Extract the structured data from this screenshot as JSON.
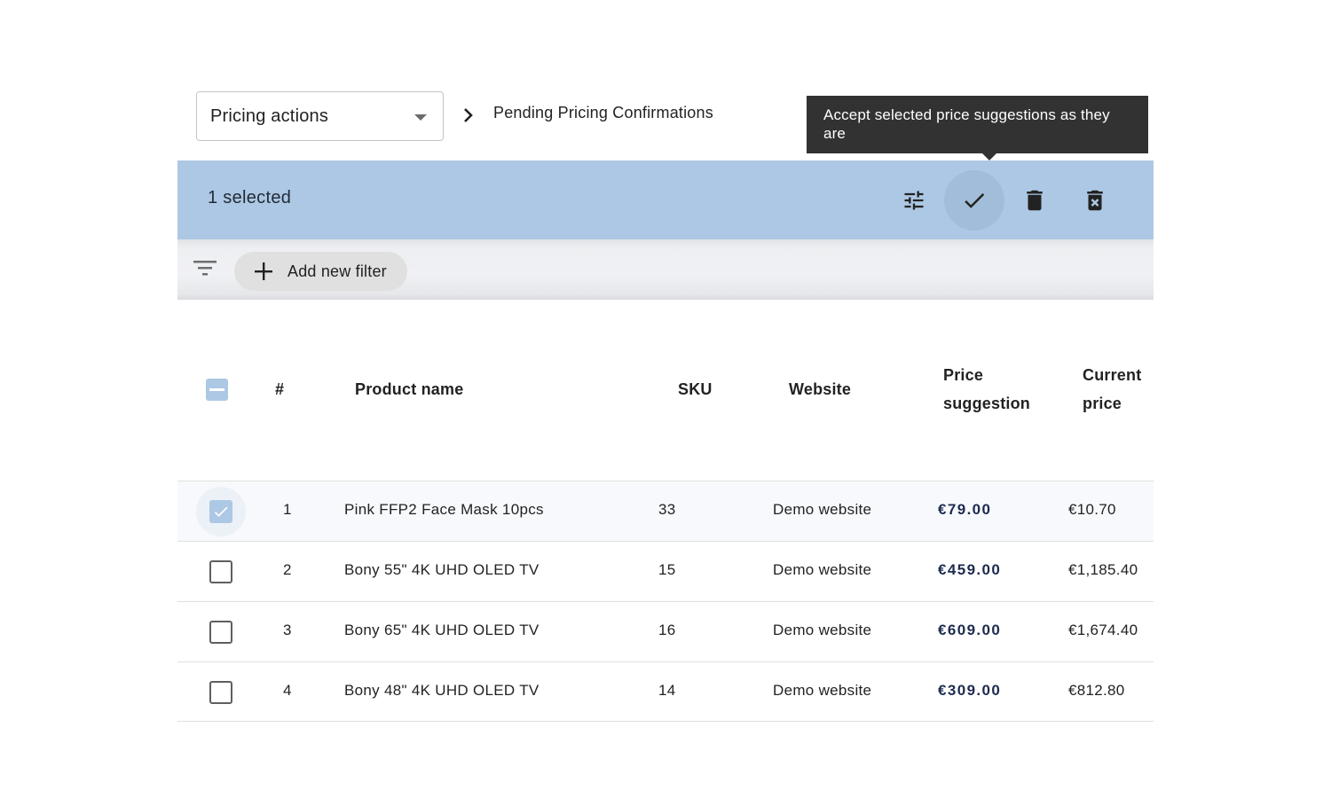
{
  "header": {
    "dropdown": {
      "value": "Pricing actions",
      "icon": "caret-down-icon"
    },
    "breadcrumb": {
      "separator_icon": "chevron-right-icon",
      "current": "Pending Pricing Confirmations"
    }
  },
  "tooltip": {
    "text": "Accept selected price suggestions as they are"
  },
  "selection_bar": {
    "count_label": "1 selected",
    "actions": [
      {
        "name": "adjust-prices",
        "icon": "tune-sliders-icon"
      },
      {
        "name": "accept-suggestions",
        "icon": "check-icon",
        "state": "hovered"
      },
      {
        "name": "delete",
        "icon": "trash-icon"
      },
      {
        "name": "delete-forever",
        "icon": "trash-x-icon"
      }
    ],
    "color": "#adc8e4"
  },
  "filter_bar": {
    "filter_icon": "filter-list-icon",
    "add_filter_label": "Add new filter",
    "add_icon": "plus-icon"
  },
  "table": {
    "header_checkbox_state": "indeterminate",
    "columns": {
      "index": "#",
      "product_name": "Product name",
      "sku": "SKU",
      "website": "Website",
      "price_suggestion_line1": "Price",
      "price_suggestion_line2": "suggestion",
      "current_price_line1": "Current",
      "current_price_line2": "price"
    },
    "rows": [
      {
        "checked": true,
        "index": "1",
        "product_name": "Pink FFP2 Face Mask 10pcs",
        "sku": "33",
        "website": "Demo website",
        "price_suggestion": "€79.00",
        "current_price": "€10.70"
      },
      {
        "checked": false,
        "index": "2",
        "product_name": "Bony 55\" 4K UHD OLED TV",
        "sku": "15",
        "website": "Demo website",
        "price_suggestion": "€459.00",
        "current_price": "€1,185.40"
      },
      {
        "checked": false,
        "index": "3",
        "product_name": "Bony 65\" 4K UHD OLED TV",
        "sku": "16",
        "website": "Demo website",
        "price_suggestion": "€609.00",
        "current_price": "€1,674.40"
      },
      {
        "checked": false,
        "index": "4",
        "product_name": "Bony 48\" 4K UHD OLED TV",
        "sku": "14",
        "website": "Demo website",
        "price_suggestion": "€309.00",
        "current_price": "€812.80"
      }
    ]
  },
  "colors": {
    "accent": "#adc8e4",
    "price_suggestion_text": "#1d2b4f",
    "tooltip_bg": "#323232"
  }
}
